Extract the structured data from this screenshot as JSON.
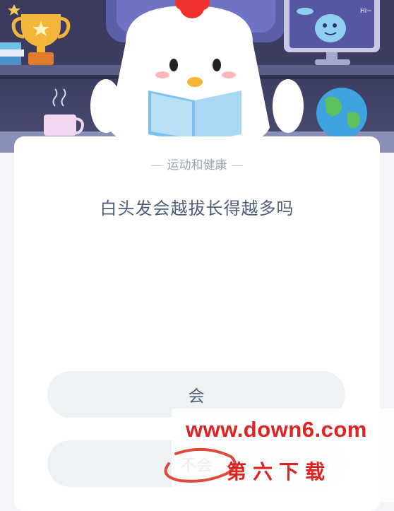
{
  "banner": {
    "mascot": "chick-reading-book",
    "monitor_greeting": "Hi~",
    "decorations": [
      "trophy-icon",
      "books-icon",
      "mug-icon",
      "globe-icon",
      "monitor-icon",
      "alien-icon"
    ]
  },
  "quiz": {
    "category": "运动和健康",
    "question": "白头发会越拔长得越多吗",
    "options": [
      {
        "label": "会"
      },
      {
        "label": "不会"
      }
    ]
  },
  "watermark": {
    "url": "www.down6.com",
    "site_name": "第六下载"
  },
  "colors": {
    "banner_bg": "#3a3a5c",
    "text_primary": "#4e5d78",
    "text_muted": "#9aa3b5",
    "option_bg": "#eef2f4",
    "watermark_red": "#e02222"
  }
}
